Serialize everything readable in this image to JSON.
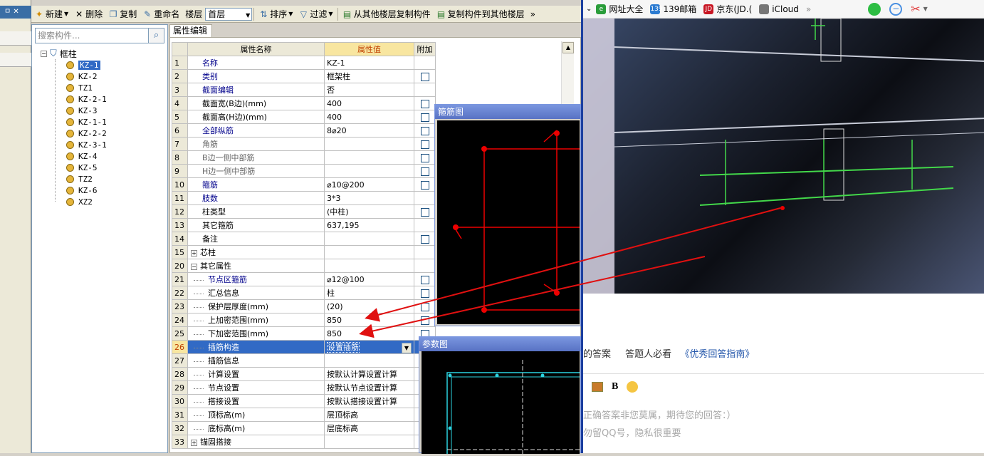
{
  "toolbar": {
    "new_label": "新建",
    "delete_label": "删除",
    "copy_label": "复制",
    "rename_label": "重命名",
    "floor_label": "楼层",
    "floor_value": "首层",
    "sort_label": "排序",
    "filter_label": "过滤",
    "copy_from_floor_label": "从其他楼层复制构件",
    "copy_to_floor_label": "复制构件到其他楼层",
    "more_label": "»"
  },
  "left_strip": {
    "pin_label": "ㅁ ✕"
  },
  "tree": {
    "search_placeholder": "搜索构件...",
    "root_label": "框柱",
    "items": [
      "KZ-1",
      "KZ-2",
      "TZ1",
      "KZ-2-1",
      "KZ-3",
      "KZ-1-1",
      "KZ-2-2",
      "KZ-3-1",
      "KZ-4",
      "KZ-5",
      "TZ2",
      "KZ-6",
      "XZ2"
    ],
    "selected_index": 0
  },
  "property_editor": {
    "tab_label": "属性编辑",
    "headers": {
      "name": "属性名称",
      "value": "属性值",
      "extra": "附加"
    },
    "rows": [
      {
        "num": "1",
        "name": "名称",
        "value": "KZ-1",
        "blue": true,
        "cb": false
      },
      {
        "num": "2",
        "name": "类别",
        "value": "框架柱",
        "blue": true,
        "cb": true
      },
      {
        "num": "3",
        "name": "截面编辑",
        "value": "否",
        "blue": true,
        "cb": false
      },
      {
        "num": "4",
        "name": "截面宽(B边)(mm)",
        "value": "400",
        "blue": false,
        "cb": true
      },
      {
        "num": "5",
        "name": "截面高(H边)(mm)",
        "value": "400",
        "blue": false,
        "cb": true
      },
      {
        "num": "6",
        "name": "全部纵筋",
        "value": "8⌀20",
        "blue": true,
        "cb": true
      },
      {
        "num": "7",
        "name": "角筋",
        "value": "",
        "grey": true,
        "cb": true
      },
      {
        "num": "8",
        "name": "B边一侧中部筋",
        "value": "",
        "grey": true,
        "cb": true
      },
      {
        "num": "9",
        "name": "H边一侧中部筋",
        "value": "",
        "grey": true,
        "cb": true
      },
      {
        "num": "10",
        "name": "箍筋",
        "value": "⌀10@200",
        "blue": true,
        "cb": true
      },
      {
        "num": "11",
        "name": "肢数",
        "value": "3*3",
        "blue": true,
        "cb": false
      },
      {
        "num": "12",
        "name": "柱类型",
        "value": "(中柱)",
        "blue": false,
        "cb": true
      },
      {
        "num": "13",
        "name": "其它箍筋",
        "value": "637,195",
        "blue": false,
        "cb": false
      },
      {
        "num": "14",
        "name": "备注",
        "value": "",
        "blue": false,
        "cb": true
      },
      {
        "num": "15",
        "name": "芯柱",
        "value": "",
        "group": "+",
        "cb": false
      },
      {
        "num": "20",
        "name": "其它属性",
        "value": "",
        "group": "−",
        "cb": false
      },
      {
        "num": "21",
        "name": "节点区箍筋",
        "value": "⌀12@100",
        "blue": true,
        "child": true,
        "cb": true
      },
      {
        "num": "22",
        "name": "汇总信息",
        "value": "柱",
        "child": true,
        "cb": true
      },
      {
        "num": "23",
        "name": "保护层厚度(mm)",
        "value": "(20)",
        "child": true,
        "cb": true
      },
      {
        "num": "24",
        "name": "上加密范围(mm)",
        "value": "850",
        "child": true,
        "cb": true
      },
      {
        "num": "25",
        "name": "下加密范围(mm)",
        "value": "850",
        "child": true,
        "cb": true
      },
      {
        "num": "26",
        "name": "插筋构造",
        "value": "设置插筋",
        "child": true,
        "selected": true,
        "cb": false
      },
      {
        "num": "27",
        "name": "插筋信息",
        "value": "",
        "child": true,
        "cb": false
      },
      {
        "num": "28",
        "name": "计算设置",
        "value": "按默认计算设置计算",
        "child": true,
        "cb": false
      },
      {
        "num": "29",
        "name": "节点设置",
        "value": "按默认节点设置计算",
        "child": true,
        "cb": false
      },
      {
        "num": "30",
        "name": "搭接设置",
        "value": "按默认搭接设置计算",
        "child": true,
        "cb": false
      },
      {
        "num": "31",
        "name": "顶标高(m)",
        "value": "层顶标高",
        "child": true,
        "cb": false
      },
      {
        "num": "32",
        "name": "底标高(m)",
        "value": "层底标高",
        "child": true,
        "cb": false
      },
      {
        "num": "33",
        "name": "锚固搭接",
        "value": "",
        "group": "+",
        "cb": false
      }
    ]
  },
  "hoop_window": {
    "title": "箍筋图"
  },
  "param_window": {
    "title": "参数图"
  },
  "browser": {
    "bookmarks": [
      {
        "label": "网址大全",
        "color": "#2a9d3a",
        "glyph": "e"
      },
      {
        "label": "139邮箱",
        "color": "#2c7bd1",
        "glyph": "139"
      },
      {
        "label": "京东(JD.(",
        "color": "#c81623",
        "glyph": "JD"
      },
      {
        "label": "iCloud",
        "color": "#777777",
        "glyph": ""
      }
    ],
    "more": "»",
    "qa_prefix": "的答案",
    "qa_link1": "答题人必看",
    "qa_link2": "《优秀回答指南》",
    "bold_btn": "B",
    "hint1": "正确答案非您莫属，期待您的回答：）",
    "hint2": "勿留QQ号，隐私很重要"
  },
  "colors": {
    "selection": "#316ac5",
    "header_value_bg": "#f8e6a0",
    "annotation_arrow": "#e01010",
    "link": "#2255aa"
  }
}
